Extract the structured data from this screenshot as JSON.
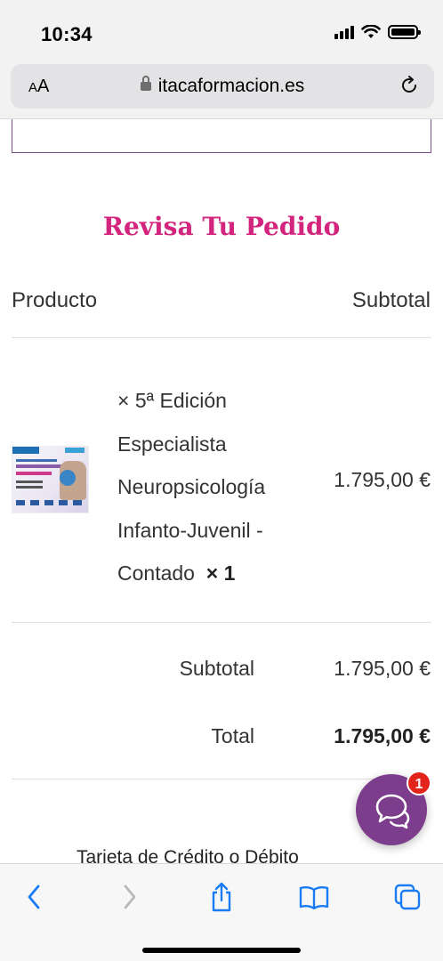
{
  "status_bar": {
    "time": "10:34"
  },
  "browser": {
    "text_size_label": "AA",
    "url": "itacaformacion.es"
  },
  "checkout": {
    "heading": "Revisa Tu Pedido",
    "col_product": "Producto",
    "col_subtotal": "Subtotal",
    "item": {
      "name": "× 5ª Edición Especialista Neuropsicología Infanto-Juvenil - Contado",
      "quantity": "× 1",
      "price": "1.795,00 €"
    },
    "subtotal_label": "Subtotal",
    "subtotal_value": "1.795,00 €",
    "total_label": "Total",
    "total_value": "1.795,00 €",
    "payment_method": "Tarjeta de Crédito o Débito"
  },
  "chat": {
    "badge_count": "1"
  },
  "colors": {
    "heading": "#d3247e",
    "chat": "#7c3d8c",
    "badge": "#e3241b",
    "ios_blue": "#1a7cf5"
  },
  "toolbar": {
    "items": [
      "back-icon",
      "forward-icon",
      "share-icon",
      "bookmarks-icon",
      "tabs-icon"
    ]
  }
}
